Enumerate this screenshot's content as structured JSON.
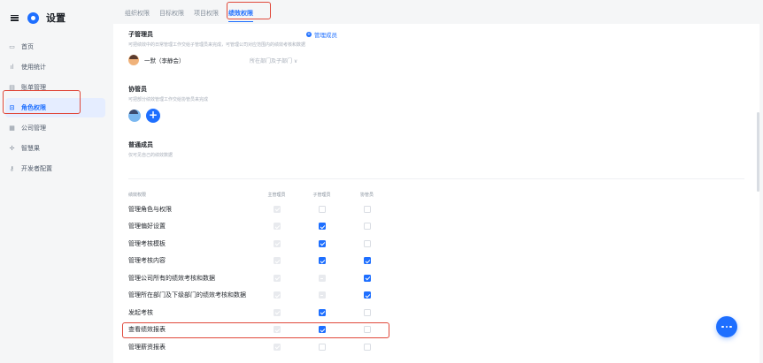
{
  "sidebar": {
    "title": "设置",
    "items": [
      {
        "label": "首页",
        "icon": "home-icon",
        "glyph": "▭"
      },
      {
        "label": "使用统计",
        "icon": "bar-chart-icon",
        "glyph": "ıl"
      },
      {
        "label": "账单管理",
        "icon": "bill-icon",
        "glyph": "▤"
      },
      {
        "label": "角色权限",
        "icon": "lock-icon",
        "glyph": "⊡"
      },
      {
        "label": "公司管理",
        "icon": "company-icon",
        "glyph": "▦"
      },
      {
        "label": "智慧果",
        "icon": "sparkle-icon",
        "glyph": "✢"
      },
      {
        "label": "开发者配置",
        "icon": "key-icon",
        "glyph": "⚷"
      }
    ]
  },
  "tabs": [
    {
      "label": "组织权限"
    },
    {
      "label": "目标权限"
    },
    {
      "label": "项目权限"
    },
    {
      "label": "绩效权限"
    }
  ],
  "admin_section": {
    "title": "子管理员",
    "description": "可把绩效中的日常管理工作交给子管理员来完成，可管理公司对应范围内的绩效考核和数据",
    "manage_link": "管理成员",
    "admin_name": "一默（李静会）",
    "dept_select": "所在部门及子部门 ∨"
  },
  "coord_section": {
    "title": "协管员",
    "description": "可把部分绩效管理工作交给协管员来完成",
    "add_label": "+"
  },
  "member_section": {
    "title": "普通成员",
    "description": "仅可见自己的绩效数据"
  },
  "perm_table": {
    "headers": [
      "绩效权限",
      "主管理员",
      "子管理员",
      "协管员"
    ],
    "rows": [
      {
        "name": "管理角色与权限",
        "cells": [
          "disabled-on",
          "off",
          "off"
        ]
      },
      {
        "name": "管理偏好设置",
        "cells": [
          "disabled-on",
          "on",
          "off"
        ]
      },
      {
        "name": "管理考核模板",
        "cells": [
          "disabled-on",
          "on",
          "off"
        ]
      },
      {
        "name": "管理考核内容",
        "cells": [
          "disabled-on",
          "on",
          "on"
        ]
      },
      {
        "name": "管理公司所有的绩效考核和数据",
        "cells": [
          "disabled-on",
          "indet",
          "on"
        ]
      },
      {
        "name": "管理所在部门及下级部门的绩效考核和数据",
        "cells": [
          "disabled-on",
          "indet",
          "on"
        ]
      },
      {
        "name": "发起考核",
        "cells": [
          "disabled-on",
          "on",
          "off"
        ]
      },
      {
        "name": "查看绩效报表",
        "cells": [
          "disabled-on",
          "on",
          "off"
        ]
      },
      {
        "name": "管理薪资报表",
        "cells": [
          "disabled-on",
          "off",
          "off"
        ]
      }
    ]
  },
  "colors": {
    "accent": "#1e6fff",
    "highlight": "#e0493b"
  }
}
